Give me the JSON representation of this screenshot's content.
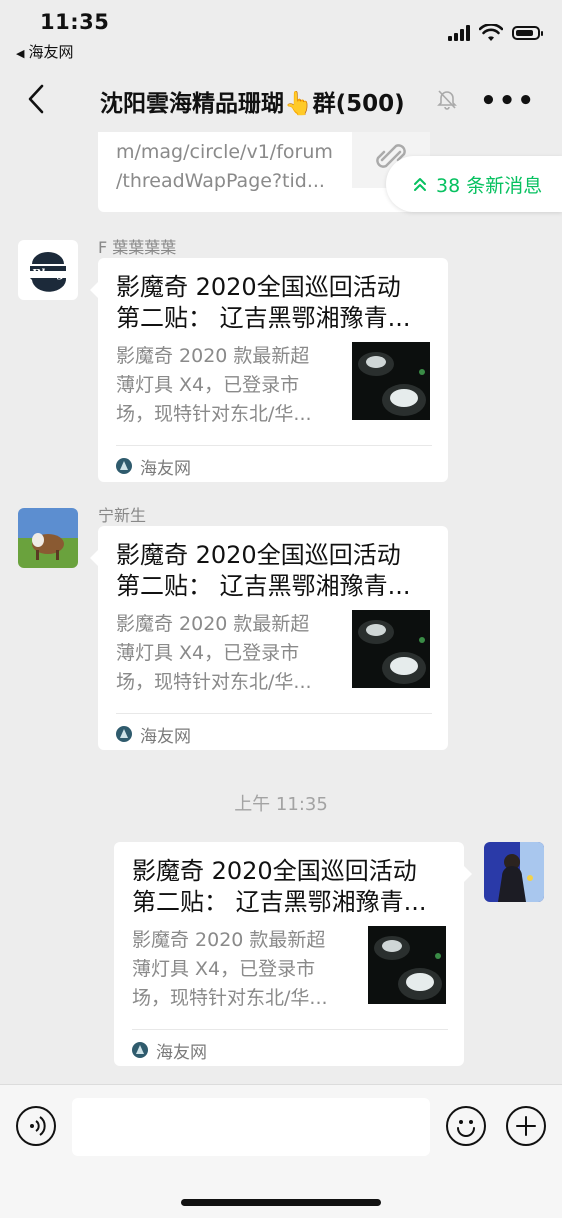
{
  "status_bar": {
    "time": "11:35",
    "back_app": "海友网"
  },
  "nav": {
    "title": "沈阳雲海精品珊瑚👆群(500)"
  },
  "new_messages": {
    "label": "38 条新消息"
  },
  "partial_message": {
    "lines": [
      "m/mag/circle/v1/forum",
      "/threadWapPage?tid..."
    ]
  },
  "messages": [
    {
      "sender": "F 葉葉葉葉",
      "avatar_text": "Blmg",
      "title_lines": [
        "影魔奇 2020全国巡回活动",
        "第二贴： 辽吉黑鄂湘豫青..."
      ],
      "desc_lines": [
        "影魔奇 2020 款最新超",
        "薄灯具 X4，已登录市",
        "场，现特针对东北/华..."
      ],
      "source": "海友网"
    },
    {
      "sender": "宁新生",
      "title_lines": [
        "影魔奇 2020全国巡回活动",
        "第二贴： 辽吉黑鄂湘豫青..."
      ],
      "desc_lines": [
        "影魔奇 2020 款最新超",
        "薄灯具 X4，已登录市",
        "场，现特针对东北/华..."
      ],
      "source": "海友网"
    },
    {
      "sender": "",
      "title_lines": [
        "影魔奇 2020全国巡回活动",
        "第二贴： 辽吉黑鄂湘豫青..."
      ],
      "desc_lines": [
        "影魔奇 2020 款最新超",
        "薄灯具 X4，已登录市",
        "场，现特针对东北/华..."
      ],
      "source": "海友网"
    }
  ],
  "time_separator": "上午 11:35",
  "input": {
    "value": "",
    "placeholder": ""
  },
  "colors": {
    "accent": "#07c160",
    "background": "#ededed",
    "bubble": "#ffffff"
  }
}
